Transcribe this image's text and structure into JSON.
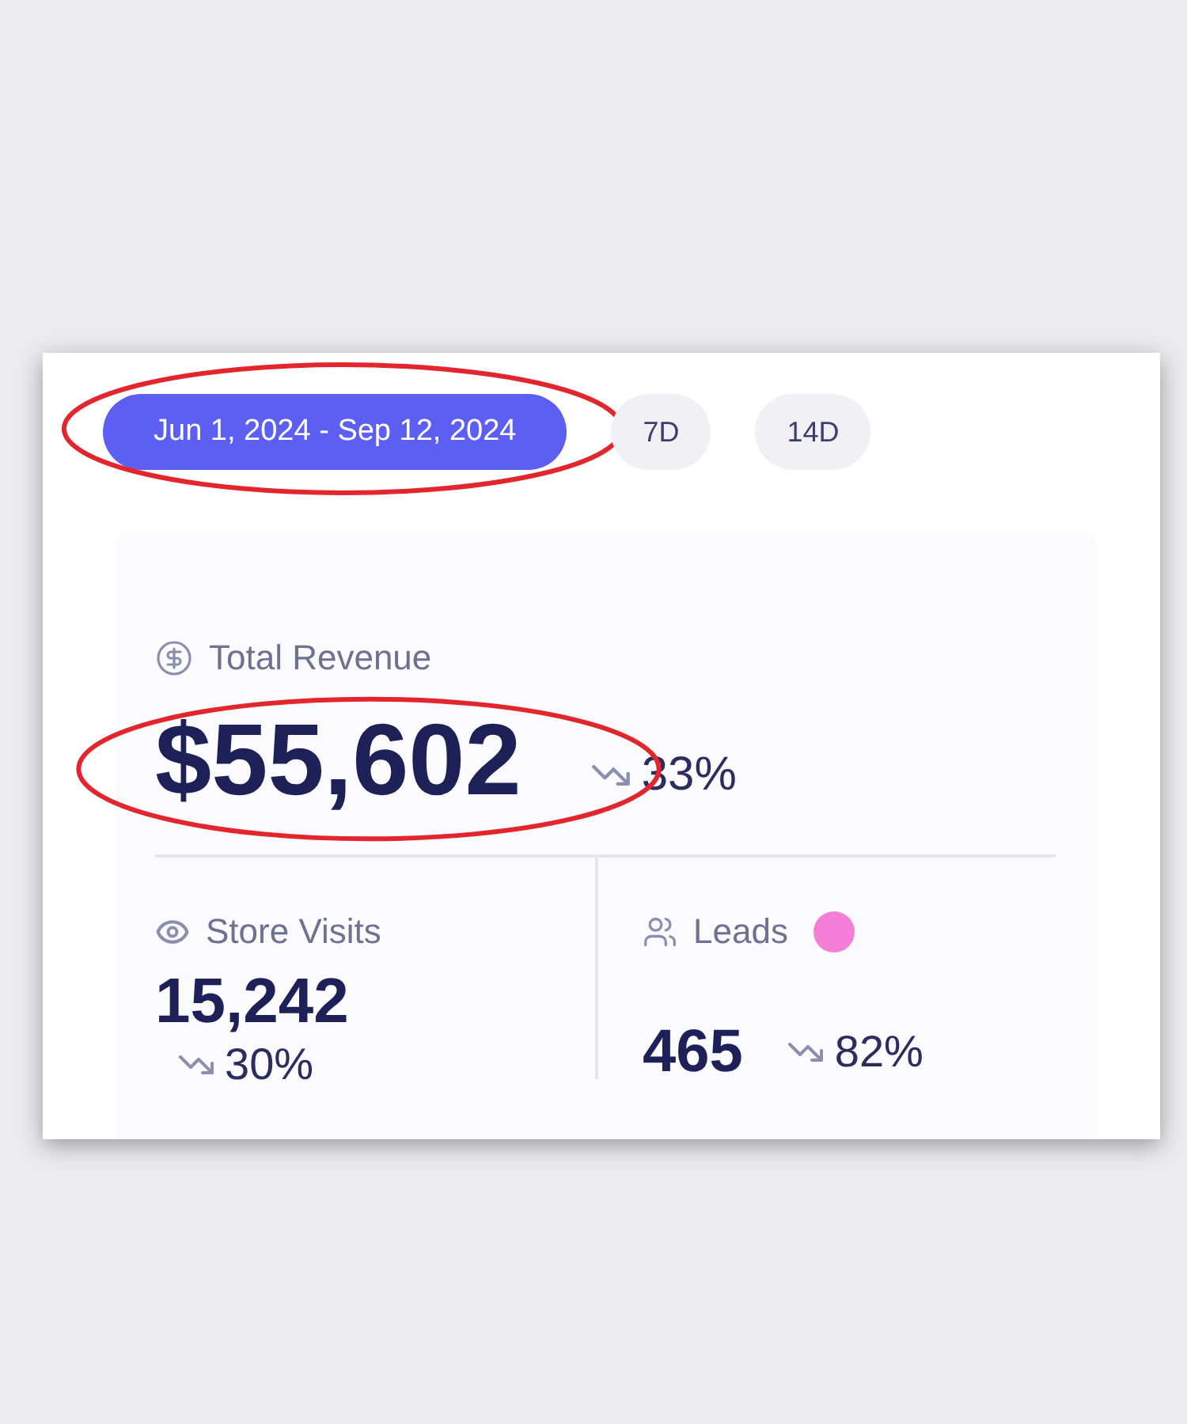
{
  "date_filters": [
    {
      "label": "Jun 1, 2024 - Sep 12, 2024",
      "selected": true,
      "circled": true
    },
    {
      "label": "7D",
      "selected": false,
      "circled": false
    },
    {
      "label": "14D",
      "selected": false,
      "circled": false
    }
  ],
  "total_revenue": {
    "label": "Total Revenue",
    "value": "$55,602",
    "change": "33%",
    "circled": true
  },
  "metrics": [
    {
      "kind": "eye",
      "label": "Store Visits",
      "value": "15,242",
      "change": "30%"
    },
    {
      "kind": "users",
      "label": "Leads",
      "value": "465",
      "change": "82%",
      "color": "#f57fd8"
    }
  ]
}
